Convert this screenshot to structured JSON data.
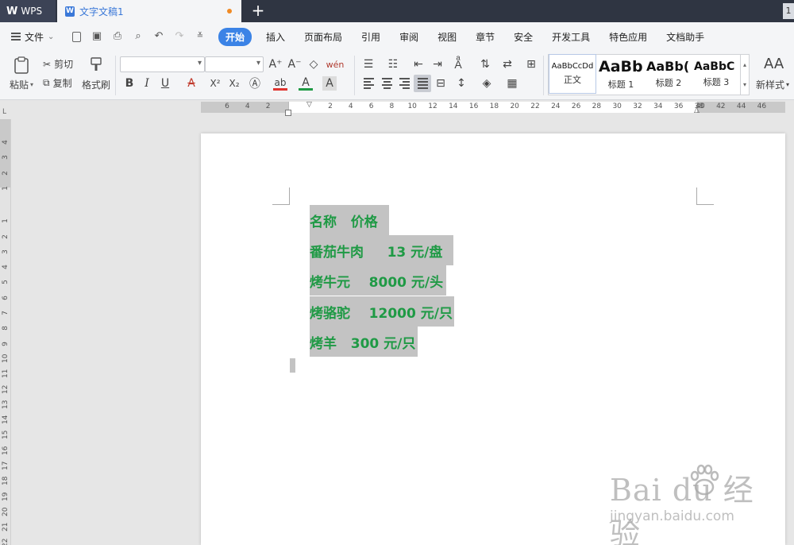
{
  "titlebar": {
    "logo_label": "WPS",
    "doc_tab_label": "文字文稿1",
    "new_tab_symbol": "+",
    "window_number": "1"
  },
  "menubar": {
    "file_label": "文件",
    "items": [
      "开始",
      "插入",
      "页面布局",
      "引用",
      "审阅",
      "视图",
      "章节",
      "安全",
      "开发工具",
      "特色应用",
      "文档助手"
    ],
    "active_item": "开始"
  },
  "ribbon": {
    "paste": "粘贴",
    "cut": "剪切",
    "copy": "复制",
    "format_painter": "格式刷",
    "font_name": "",
    "font_size": "",
    "grow_font": "A⁺",
    "shrink_font": "A⁻",
    "bold": "B",
    "italic": "I",
    "underline": "U",
    "strikethrough": "A",
    "superscript": "X²",
    "subscript": "X₂",
    "styles": [
      {
        "sample": "AaBbCcDd",
        "label": "正文"
      },
      {
        "sample": "AaBb",
        "label": "标题 1"
      },
      {
        "sample": "AaBb(",
        "label": "标题 2"
      },
      {
        "sample": "AaBbC",
        "label": "标题 3"
      }
    ],
    "new_style": "新样式",
    "new_style_sample": "AA"
  },
  "ruler": {
    "h_numbers_left": [
      "6",
      "4",
      "2"
    ],
    "h_numbers_main": [
      "2",
      "4",
      "6",
      "8",
      "10",
      "12",
      "14",
      "16",
      "18",
      "20",
      "22",
      "24",
      "26",
      "28",
      "30",
      "32",
      "34",
      "36",
      "38"
    ],
    "h_numbers_right": [
      "40",
      "42",
      "44",
      "46"
    ],
    "corner_mark": "L",
    "v_numbers": [
      "4",
      "3",
      "2",
      "1",
      "1",
      "2",
      "3",
      "4",
      "5",
      "6",
      "7",
      "8",
      "9",
      "10",
      "11",
      "12",
      "13",
      "14",
      "15",
      "16",
      "17",
      "18",
      "19",
      "20",
      "21",
      "22"
    ]
  },
  "document": {
    "lines": [
      "名称   价格",
      "番茄牛肉     13 元/盘",
      "烤牛元    8000 元/头",
      "烤骆驼    12000 元/只",
      "烤羊   300 元/只"
    ],
    "text_color": "#1f9a45",
    "highlight_color": "#c3c3c3"
  },
  "watermark": {
    "main": "Bai  du 经验",
    "url": "jingyan.baidu.com"
  }
}
